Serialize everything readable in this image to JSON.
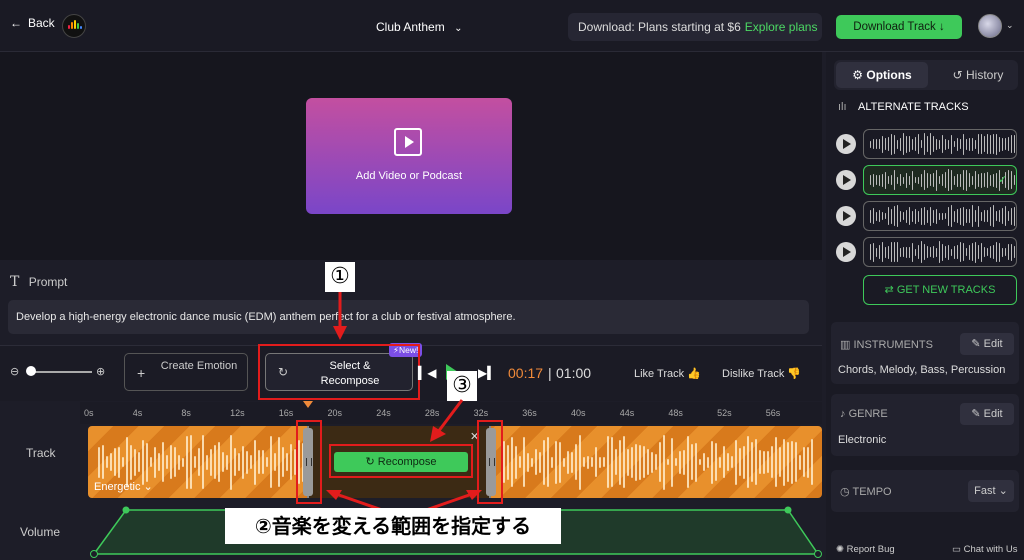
{
  "topbar": {
    "back_label": "Back",
    "title": "Club Anthem",
    "promo_text": "Download: Plans starting at $6",
    "promo_link": "Explore plans",
    "download_label": "Download Track",
    "download_arrow": "↓",
    "back_arrow": "←",
    "title_caret": "⌄",
    "avatar_caret": "⌄"
  },
  "video": {
    "label": "Add Video or Podcast"
  },
  "prompt": {
    "label": "Prompt",
    "icon": "T",
    "text": "Develop a high-energy electronic dance music (EDM) anthem perfect for a club or festival atmosphere."
  },
  "controls": {
    "zoom_minus": "⊖",
    "zoom_plus": "⊕",
    "create_emotion_plus": "+",
    "create_emotion_label": "Create Emotion",
    "select_icon": "↻",
    "select_label": "Select & Recompose",
    "new_badge": "⚡New!",
    "prev_icon": "▍◀",
    "next_icon": "▶▍",
    "current_time": "00:17",
    "separator": "|",
    "total_time": "01:00",
    "like_label": "Like Track 👍",
    "dislike_label": "Dislike Track 👎"
  },
  "timeline": {
    "ticks": [
      "0s",
      "4s",
      "8s",
      "12s",
      "16s",
      "20s",
      "24s",
      "28s",
      "32s",
      "36s",
      "40s",
      "44s",
      "48s",
      "52s",
      "56s"
    ],
    "track_label": "Track",
    "recompose_label": "↻  Recompose",
    "close": "✕",
    "emotion_label": "Energetic ⌄",
    "volume_label": "Volume"
  },
  "annotations": {
    "one": "①",
    "two": "②音楽を変える範囲を指定する",
    "three": "③"
  },
  "sidebar": {
    "tab_options": "⚙ Options",
    "tab_history": "↺ History",
    "alt_icon": "ılı",
    "alt_title": "ALTERNATE TRACKS",
    "selected_check": "✓",
    "get_new": "⇄  GET NEW TRACKS",
    "instruments_title": "INSTRUMENTS",
    "instruments_value": "Chords, Melody, Bass, Percussion",
    "genre_title": "GENRE",
    "genre_value": "Electronic",
    "tempo_title": "TEMPO",
    "tempo_value": "Fast ⌄",
    "edit_label": "✎ Edit",
    "report_bug": "✺ Report Bug",
    "chat": "▭ Chat with Us",
    "instruments_icon": "▥",
    "genre_icon": "♪",
    "tempo_icon": "◷"
  },
  "colors": {
    "accent_green": "#3ec95a",
    "track_orange": "#e8902c",
    "time_orange": "#f08a3a",
    "annotation_red": "#e21c1c",
    "badge_purple": "#7b4ee6"
  }
}
